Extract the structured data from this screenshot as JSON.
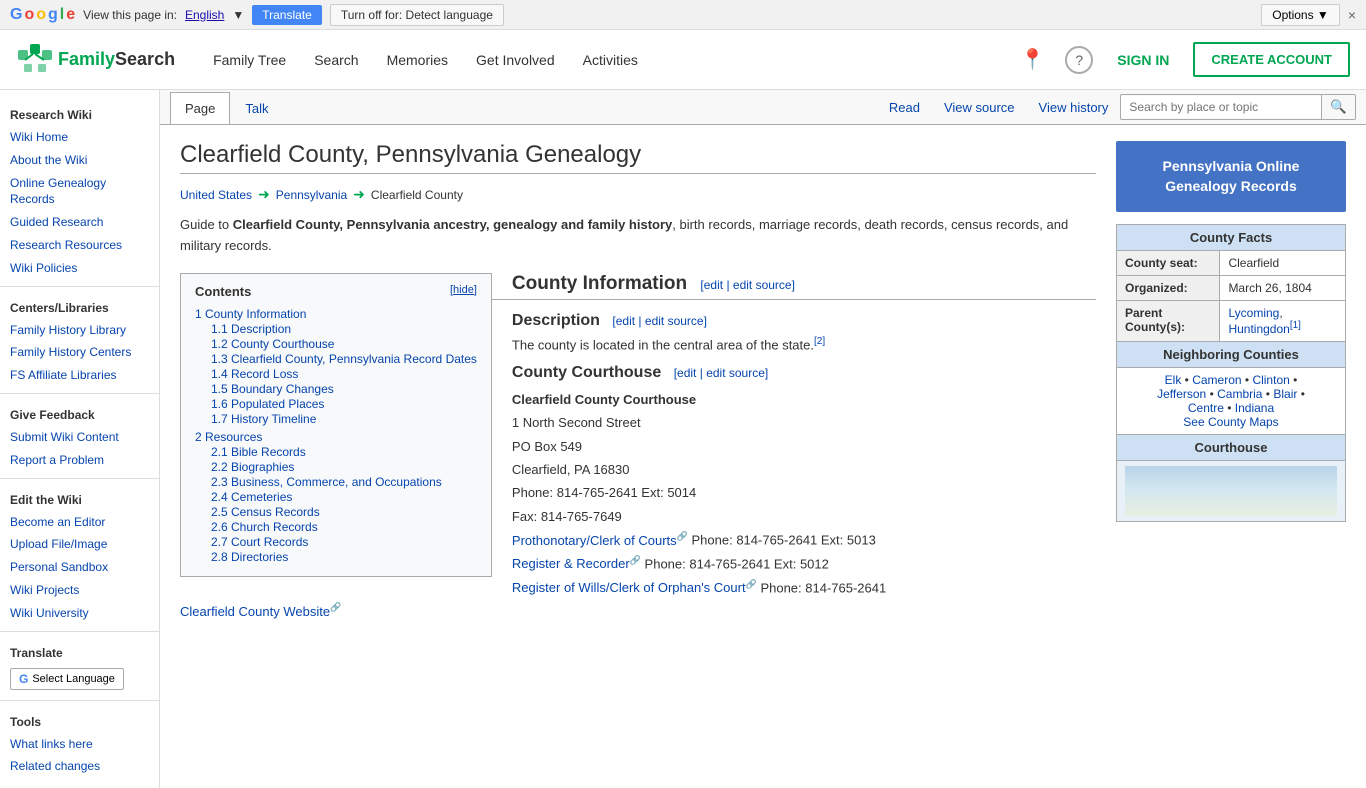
{
  "translate_bar": {
    "label": "View this page in:",
    "lang_link": "English",
    "dropdown_indicator": "▼",
    "translate_btn": "Translate",
    "turn_off_btn": "Turn off for: Detect language",
    "options_btn": "Options ▼",
    "close_btn": "×"
  },
  "header": {
    "logo_text_family": "Family",
    "logo_text_search": "Search",
    "nav": [
      {
        "label": "Family Tree",
        "id": "family-tree"
      },
      {
        "label": "Search",
        "id": "search"
      },
      {
        "label": "Memories",
        "id": "memories"
      },
      {
        "label": "Get Involved",
        "id": "get-involved"
      },
      {
        "label": "Activities",
        "id": "activities"
      }
    ],
    "sign_in": "SIGN IN",
    "create_account": "CREATE ACCOUNT",
    "location_icon": "📍",
    "help_icon": "?"
  },
  "sidebar": {
    "sections": [
      {
        "title": "Research Wiki",
        "links": [
          {
            "label": "Wiki Home",
            "href": "#"
          },
          {
            "label": "About the Wiki",
            "href": "#"
          },
          {
            "label": "Online Genealogy Records",
            "href": "#"
          },
          {
            "label": "Guided Research",
            "href": "#"
          },
          {
            "label": "Research Resources",
            "href": "#"
          },
          {
            "label": "Wiki Policies",
            "href": "#"
          }
        ]
      },
      {
        "title": "Centers/Libraries",
        "links": [
          {
            "label": "Family History Library",
            "href": "#"
          },
          {
            "label": "Family History Centers",
            "href": "#"
          },
          {
            "label": "FS Affiliate Libraries",
            "href": "#"
          }
        ]
      },
      {
        "title": "Give Feedback",
        "links": [
          {
            "label": "Submit Wiki Content",
            "href": "#"
          },
          {
            "label": "Report a Problem",
            "href": "#"
          }
        ]
      },
      {
        "title": "Edit the Wiki",
        "links": [
          {
            "label": "Become an Editor",
            "href": "#"
          },
          {
            "label": "Upload File/Image",
            "href": "#"
          },
          {
            "label": "Personal Sandbox",
            "href": "#"
          },
          {
            "label": "Wiki Projects",
            "href": "#"
          },
          {
            "label": "Wiki University",
            "href": "#"
          }
        ]
      },
      {
        "title": "Translate",
        "links": []
      },
      {
        "title": "Tools",
        "links": [
          {
            "label": "What links here",
            "href": "#"
          },
          {
            "label": "Related changes",
            "href": "#"
          }
        ]
      }
    ]
  },
  "tabs": {
    "page_label": "Page",
    "talk_label": "Talk",
    "read_label": "Read",
    "view_source_label": "View source",
    "view_history_label": "View history",
    "search_placeholder": "Search by place or topic"
  },
  "article": {
    "title": "Clearfield County, Pennsylvania Genealogy",
    "breadcrumb": {
      "us": "United States",
      "pa": "Pennsylvania",
      "county": "Clearfield County"
    },
    "intro": "Guide to Clearfield County, Pennsylvania ancestry, genealogy and family history, birth records, marriage records, death records, census records, and military records.",
    "county_info_header": "County Information",
    "description_header": "Description",
    "description_text": "The county is located in the central area of the state.",
    "desc_footnote": "[2]",
    "courthouse_header": "County Courthouse",
    "courthouse": {
      "name": "Clearfield County Courthouse",
      "address1": "1 North Second Street",
      "address2": "PO Box 549",
      "city_state_zip": "Clearfield, PA 16830",
      "phone": "Phone: 814-765-2641 Ext: 5014",
      "fax": "Fax: 814-765-7649",
      "prothonotary_label": "Prothonotary/Clerk of Courts",
      "prothonotary_phone": "Phone: 814-765-2641 Ext: 5013",
      "register_recorder_label": "Register & Recorder",
      "register_recorder_phone": "Phone: 814-765-2641 Ext: 5012",
      "register_wills_label": "Register of Wills/Clerk of Orphan's Court",
      "register_wills_phone": "Phone: 814-765-2641",
      "website_label": "Clearfield County Website"
    },
    "contents": {
      "title": "Contents",
      "hide_label": "hide",
      "items": [
        {
          "num": "1",
          "label": "County Information",
          "sub": [
            {
              "num": "1.1",
              "label": "Description"
            },
            {
              "num": "1.2",
              "label": "County Courthouse"
            },
            {
              "num": "1.3",
              "label": "Clearfield County, Pennsylvania Record Dates"
            },
            {
              "num": "1.4",
              "label": "Record Loss"
            },
            {
              "num": "1.5",
              "label": "Boundary Changes"
            },
            {
              "num": "1.6",
              "label": "Populated Places"
            },
            {
              "num": "1.7",
              "label": "History Timeline"
            }
          ]
        },
        {
          "num": "2",
          "label": "Resources",
          "sub": [
            {
              "num": "2.1",
              "label": "Bible Records"
            },
            {
              "num": "2.2",
              "label": "Biographies"
            },
            {
              "num": "2.3",
              "label": "Business, Commerce, and Occupations"
            },
            {
              "num": "2.4",
              "label": "Cemeteries"
            },
            {
              "num": "2.5",
              "label": "Census Records"
            },
            {
              "num": "2.6",
              "label": "Church Records"
            },
            {
              "num": "2.7",
              "label": "Court Records"
            },
            {
              "num": "2.8",
              "label": "Directories"
            }
          ]
        }
      ]
    }
  },
  "right_sidebar": {
    "pa_online_btn": "Pennsylvania Online\nGenealogy Records",
    "county_facts": {
      "title": "County Facts",
      "seat_label": "County seat:",
      "seat_value": "Clearfield",
      "organized_label": "Organized:",
      "organized_value": "March 26, 1804",
      "parent_label": "Parent County(s):",
      "parent_value": "Lycoming, Huntingdon",
      "parent_footnote": "[1]",
      "neighboring_title": "Neighboring Counties",
      "neighbors": "Elk • Cameron • Clinton • Jefferson • Cambria • Blair • Centre • Indiana",
      "see_maps": "See County Maps",
      "courthouse_title": "Courthouse"
    }
  }
}
